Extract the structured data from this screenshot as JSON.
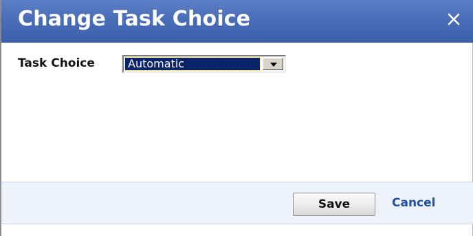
{
  "dialog": {
    "title": "Change Task Choice",
    "close_icon": "close-icon"
  },
  "form": {
    "task_choice_label": "Task Choice",
    "task_choice_value": "Automatic",
    "dropdown_icon": "dropdown-arrow-icon"
  },
  "footer": {
    "save_label": "Save",
    "cancel_label": "Cancel"
  },
  "colors": {
    "titlebar": "#4a6db8",
    "footer_bg": "#eef3fb",
    "link": "#1f4ea3",
    "selection": "#0a246a"
  }
}
